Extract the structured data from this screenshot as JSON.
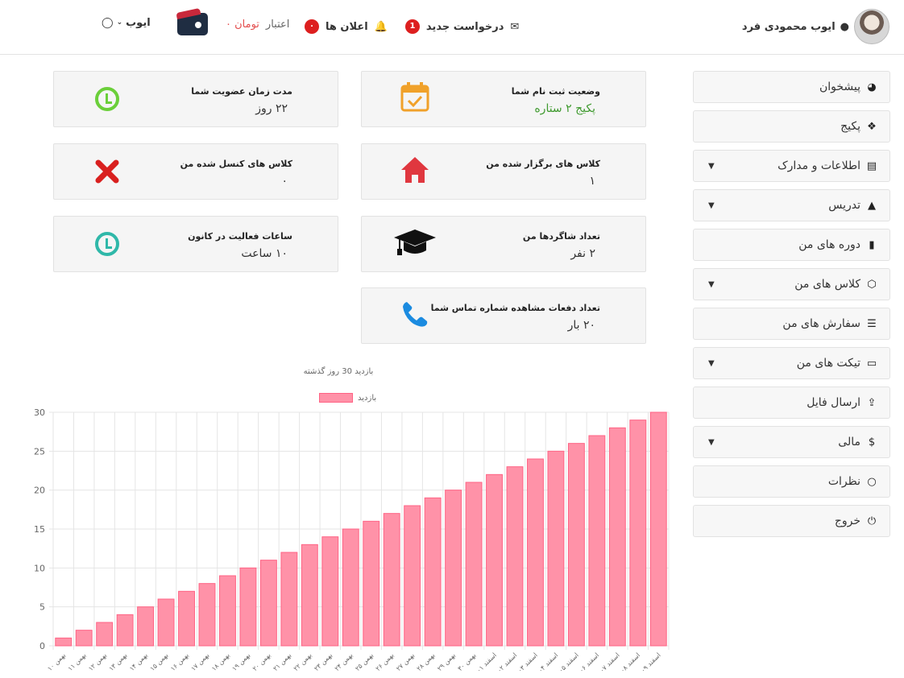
{
  "header": {
    "user_name": "ایوب محمودی فرد",
    "new_request_label": "درخواست جدید",
    "new_request_count": "1",
    "announcements_label": "اعلان ها",
    "announcements_count": "۰",
    "credit_label": "اعتبار",
    "credit_value": "تومان ۰",
    "user_menu_label": "ایوب"
  },
  "sidebar": {
    "items": [
      {
        "label": "پیشخوان",
        "icon": "dashboard-icon",
        "has_caret": false
      },
      {
        "label": "پکیج",
        "icon": "cubes-icon",
        "has_caret": false
      },
      {
        "label": "اطلاعات و مدارک",
        "icon": "id-card-icon",
        "has_caret": true
      },
      {
        "label": "تدریس",
        "icon": "graduation-cap-icon",
        "has_caret": true
      },
      {
        "label": "دوره های من",
        "icon": "file-icon",
        "has_caret": false
      },
      {
        "label": "کلاس های من",
        "icon": "codepen-icon",
        "has_caret": true
      },
      {
        "label": "سفارش های من",
        "icon": "list-icon",
        "has_caret": false
      },
      {
        "label": "تیکت های من",
        "icon": "inbox-icon",
        "has_caret": true
      },
      {
        "label": "ارسال فایل",
        "icon": "upload-icon",
        "has_caret": false
      },
      {
        "label": "مالی",
        "icon": "dollar-icon",
        "has_caret": true
      },
      {
        "label": "نظرات",
        "icon": "comment-icon",
        "has_caret": false
      },
      {
        "label": "خروج",
        "icon": "power-icon",
        "has_caret": false
      }
    ]
  },
  "cards": {
    "registration": {
      "title": "وضعیت ثبت نام شما",
      "value": "پکیج ۲ ستاره",
      "icon": "calendar-check-icon"
    },
    "membership": {
      "title": "مدت زمان عضویت شما",
      "value": "۲۲ روز",
      "icon": "clock-icon"
    },
    "held_classes": {
      "title": "کلاس های برگزار شده من",
      "value": "۱",
      "icon": "home-icon"
    },
    "cancelled_classes": {
      "title": "کلاس های کنسل شده من",
      "value": "۰",
      "icon": "x-icon"
    },
    "students": {
      "title": "تعداد شاگردها من",
      "value": "۲ نفر",
      "icon": "graduation-cap-icon"
    },
    "activity_hours": {
      "title": "ساعات فعالیت در کانون",
      "value": "۱۰ ساعت",
      "icon": "clock-icon"
    },
    "phone_views": {
      "title": "تعداد دفعات مشاهده شماره تماس شما",
      "value": "۲۰ بار",
      "icon": "phone-icon"
    }
  },
  "chart_data": {
    "type": "bar",
    "title": "بازدید 30 روز گذشته",
    "legend_position": "top",
    "grid": true,
    "ylim": [
      0,
      30
    ],
    "yticks": [
      0,
      5,
      10,
      15,
      20,
      25,
      30
    ],
    "categories": [
      "۱۰ بهمن",
      "۱۱ بهمن",
      "۱۲ بهمن",
      "۱۳ بهمن",
      "۱۴ بهمن",
      "۱۵ بهمن",
      "۱۶ بهمن",
      "۱۷ بهمن",
      "۱۸ بهمن",
      "۱۹ بهمن",
      "۲۰ بهمن",
      "۲۱ بهمن",
      "۲۲ بهمن",
      "۲۳ بهمن",
      "۲۴ بهمن",
      "۲۵ بهمن",
      "۲۶ بهمن",
      "۲۷ بهمن",
      "۲۸ بهمن",
      "۲۹ بهمن",
      "۳۰ بهمن",
      "۰۱ اسفند",
      "۰۲ اسفند",
      "۰۳ اسفند",
      "۰۴ اسفند",
      "۰۵ اسفند",
      "۰۶ اسفند",
      "۰۷ اسفند",
      "۰۸ اسفند",
      "۰۹ اسفند"
    ],
    "series": [
      {
        "name": "بازدید",
        "color": "#ff92a8",
        "values": [
          1,
          2,
          3,
          4,
          5,
          6,
          7,
          8,
          9,
          10,
          11,
          12,
          13,
          14,
          15,
          16,
          17,
          18,
          19,
          20,
          21,
          22,
          23,
          24,
          25,
          26,
          27,
          28,
          29,
          30
        ]
      }
    ]
  }
}
